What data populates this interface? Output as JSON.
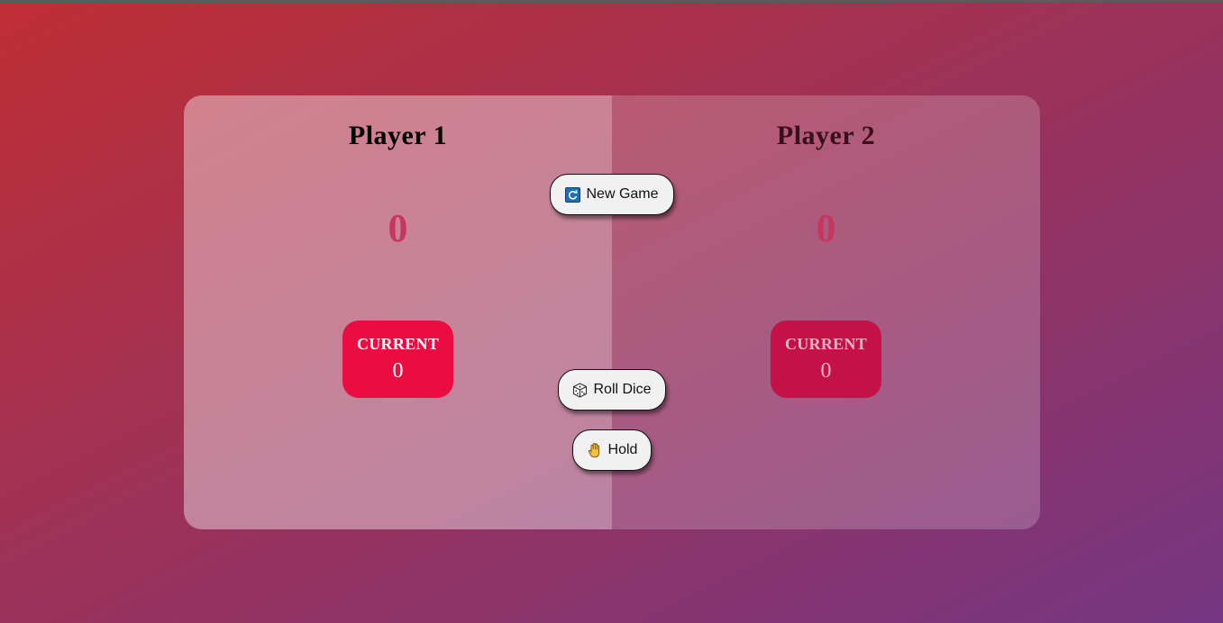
{
  "players": [
    {
      "name": "Player 1",
      "score": "0",
      "current_label": "CURRENT",
      "current_score": "0",
      "active": true
    },
    {
      "name": "Player 2",
      "score": "0",
      "current_label": "CURRENT",
      "current_score": "0",
      "active": false
    }
  ],
  "buttons": {
    "new_game": {
      "label": "New Game",
      "icon": "refresh-icon"
    },
    "roll_dice": {
      "label": "Roll Dice",
      "icon": "dice-icon"
    },
    "hold": {
      "label": "Hold",
      "icon": "hand-icon"
    }
  },
  "colors": {
    "background_start": "#bf2e34",
    "background_end": "#753682",
    "current_active": "#eb0c42",
    "score_color": "#c7365f"
  }
}
